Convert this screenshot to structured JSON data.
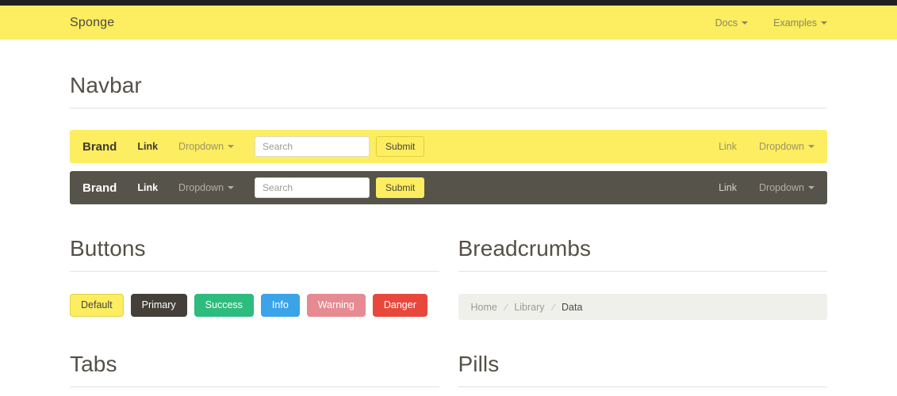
{
  "site": {
    "brand": "Sponge",
    "nav": [
      {
        "label": "Docs",
        "caret": "chevron-down-icon"
      },
      {
        "label": "Examples",
        "caret": "chevron-down-icon"
      }
    ]
  },
  "sections": {
    "navbar_title": "Navbar",
    "buttons_title": "Buttons",
    "breadcrumbs_title": "Breadcrumbs",
    "tabs_title": "Tabs",
    "pills_title": "Pills"
  },
  "demo_navbars": [
    {
      "variant": "light",
      "brand": "Brand",
      "link": "Link",
      "dropdown": "Dropdown",
      "search_placeholder": "Search",
      "search_value": "",
      "submit": "Submit",
      "right_link": "Link",
      "right_dropdown": "Dropdown",
      "bg": "#fced61"
    },
    {
      "variant": "dark",
      "brand": "Brand",
      "link": "Link",
      "dropdown": "Dropdown",
      "search_placeholder": "Search",
      "search_value": "",
      "submit": "Submit",
      "right_link": "Link",
      "right_dropdown": "Dropdown",
      "bg": "#56534a"
    }
  ],
  "buttons": [
    {
      "label": "Default",
      "bg": "#fced61",
      "fg": "#4a4538",
      "border": "#e2d243"
    },
    {
      "label": "Primary",
      "bg": "#443f38",
      "fg": "#ffffff",
      "border": "#443f38"
    },
    {
      "label": "Success",
      "bg": "#2dbc7d",
      "fg": "#ffffff",
      "border": "#2dbc7d"
    },
    {
      "label": "Info",
      "bg": "#3ba3e8",
      "fg": "#ffffff",
      "border": "#3ba3e8"
    },
    {
      "label": "Warning",
      "bg": "#e58b91",
      "fg": "#ffffff",
      "border": "#e58b91"
    },
    {
      "label": "Danger",
      "bg": "#e8483c",
      "fg": "#ffffff",
      "border": "#e8483c"
    }
  ],
  "breadcrumb": {
    "items": [
      {
        "label": "Home",
        "active": false
      },
      {
        "label": "Library",
        "active": false
      },
      {
        "label": "Data",
        "active": true
      }
    ],
    "separator": "/"
  }
}
